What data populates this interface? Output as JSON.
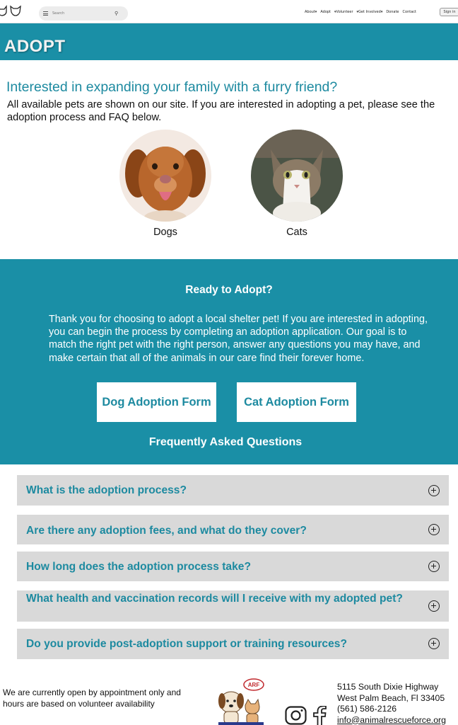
{
  "nav": {
    "search_placeholder": "Search",
    "links": [
      "About",
      "Adopt",
      "Volunteer",
      "Get Involved",
      "Donate",
      "Contact"
    ],
    "sign_in": "Sign in"
  },
  "hero": {
    "title": "ADOPT"
  },
  "intro": {
    "heading": "Interested in expanding your family with a furry friend?",
    "body": "All available pets are shown on our site. If you are interested in adopting a pet, please see the adoption process and FAQ below."
  },
  "pets": [
    {
      "label": "Dogs",
      "icon": "dog-photo"
    },
    {
      "label": "Cats",
      "icon": "cat-photo"
    }
  ],
  "ready": {
    "heading": "Ready to Adopt?",
    "body": "Thank you for choosing to adopt a local shelter pet! If you are interested in adopting, you can begin the process by completing an adoption application. Our goal is to match the right pet with the right person, answer any questions you may have, and make certain that all of the animals in our care find their forever home.",
    "dog_form": "Dog Adoption Form",
    "cat_form": "Cat Adoption Form",
    "faq_heading": "Frequently Asked Questions"
  },
  "faq": [
    {
      "question": "What is the adoption process?"
    },
    {
      "question": "Are there any adoption fees, and what do they cover?"
    },
    {
      "question": "How long does the adoption process take?"
    },
    {
      "question": "What health and vaccination records will I receive with my adopted pet?"
    },
    {
      "question": "Do you provide post-adoption support or training resources?"
    }
  ],
  "footer": {
    "hours": "We are currently open by appointment only and hours are based on volunteer availability",
    "logo_text": "ARF",
    "address_line1": "5115 South Dixie Highway",
    "address_line2": "West Palm Beach, Fl 33405",
    "phone": "(561) 586-2126",
    "email": "info@animalrescueforce.org"
  },
  "colors": {
    "teal": "#1a8fa6",
    "faq_bg": "#d9d9d9",
    "faq_text": "#1d8aa0"
  }
}
